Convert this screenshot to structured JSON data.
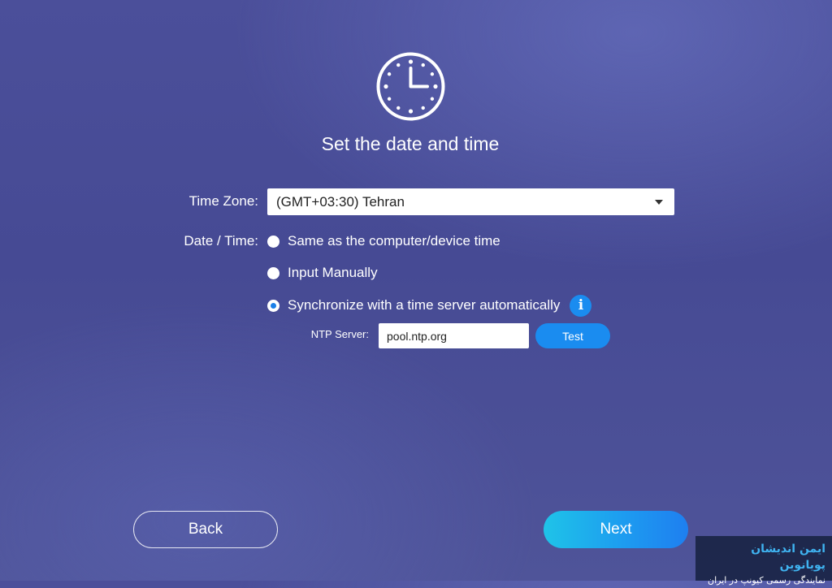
{
  "header": {
    "icon": "clock-icon",
    "title": "Set the date and time"
  },
  "timezone": {
    "label": "Time Zone:",
    "selected": "(GMT+03:30) Tehran"
  },
  "datetime": {
    "label": "Date / Time:",
    "options": [
      {
        "label": "Same as the computer/device time",
        "checked": false
      },
      {
        "label": "Input Manually",
        "checked": false
      },
      {
        "label": "Synchronize with a time server automatically",
        "checked": true
      }
    ],
    "info_icon": "info-icon",
    "ntp": {
      "label": "NTP Server:",
      "value": "pool.ntp.org",
      "test_label": "Test"
    }
  },
  "footer": {
    "back_label": "Back",
    "next_label": "Next"
  },
  "watermark": {
    "title": "ایمن اندیشان پویانوین",
    "subtitle": "نمایندگی رسمی کیونپ در ایران"
  },
  "colors": {
    "accent": "#1a8cf0",
    "background": "#484c96"
  }
}
